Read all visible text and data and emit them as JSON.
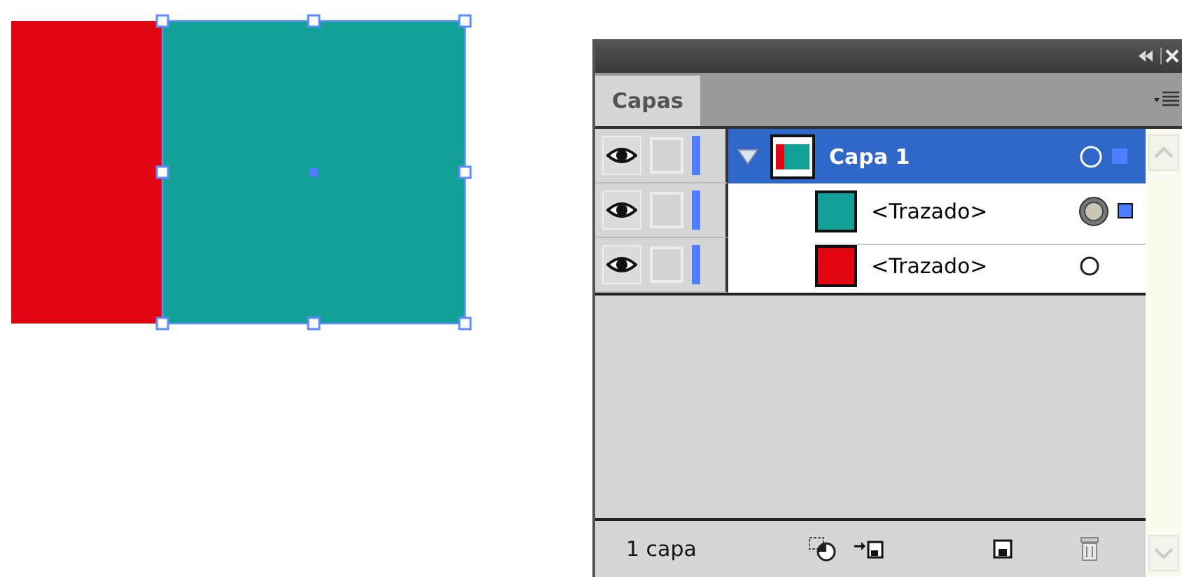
{
  "artboard": {
    "shapes": [
      {
        "color": "#e20613",
        "selected": false
      },
      {
        "color": "#12a098",
        "selected": true
      }
    ]
  },
  "panel": {
    "tabs": [
      {
        "label": "Capas",
        "selected": true
      }
    ],
    "layers": [
      {
        "name": "Capa 1",
        "selected": true,
        "expanded": true,
        "visible": true,
        "color": "#4f7fff",
        "children": [
          {
            "name": "<Trazado>",
            "color": "#12a098",
            "visible": true,
            "targeted": true,
            "selected": true
          },
          {
            "name": "<Trazado>",
            "color": "#e20613",
            "visible": true,
            "targeted": false,
            "selected": false
          }
        ]
      }
    ],
    "status": "1 capa"
  }
}
